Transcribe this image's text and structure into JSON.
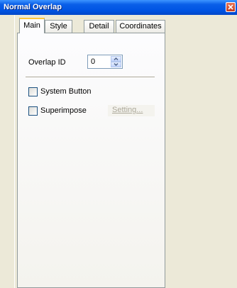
{
  "window": {
    "title": "Normal Overlap"
  },
  "tabs": [
    {
      "label": "Main",
      "active": true
    },
    {
      "label": "Style",
      "active": false
    },
    {
      "label": "Detail",
      "active": false
    },
    {
      "label": "Coordinates",
      "active": false
    }
  ],
  "main": {
    "overlap_id_label": "Overlap ID",
    "overlap_id_value": "0",
    "system_button_label": "System Button",
    "system_button_checked": false,
    "superimpose_label": "Superimpose",
    "superimpose_checked": false,
    "setting_button_label": "Setting..."
  },
  "colors": {
    "titlebar": "#0054e3",
    "active_tab_accent": "#ffc83c",
    "close_button": "#c43b1c"
  }
}
